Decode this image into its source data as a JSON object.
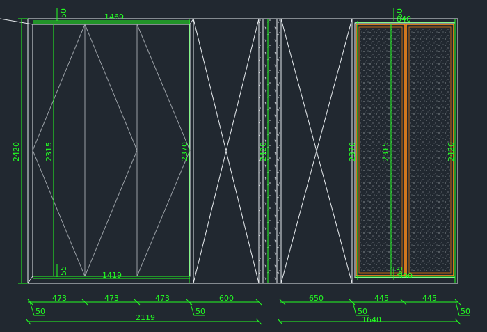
{
  "drawing": {
    "background": "#212830",
    "colors": {
      "dimension": "#22ff22",
      "outline": "#e8ecef",
      "frame": "#ff8c1a"
    },
    "icons": [
      "hatch-pattern",
      "stone-pattern"
    ],
    "dimensions": {
      "top_offset_left": "50",
      "top_width_left": "1469",
      "height_overall_left": "2420",
      "height_inner_left": "2315",
      "height_panel_mid": "2370",
      "height_mid_column": "2420",
      "bottom_offset_left": "55",
      "bottom_width_left": "1419",
      "height_right_a": "2370",
      "height_right_b": "2315",
      "height_right_c": "2420",
      "top_offset_right": "50",
      "top_width_right": "840",
      "bottom_offset_right": "55",
      "bottom_width_right": "890",
      "row1": [
        "473",
        "473",
        "473",
        "600",
        "650",
        "445",
        "445"
      ],
      "row2": [
        "50",
        "50",
        "50",
        "50"
      ],
      "total_left": "2119",
      "total_right": "1640"
    }
  }
}
